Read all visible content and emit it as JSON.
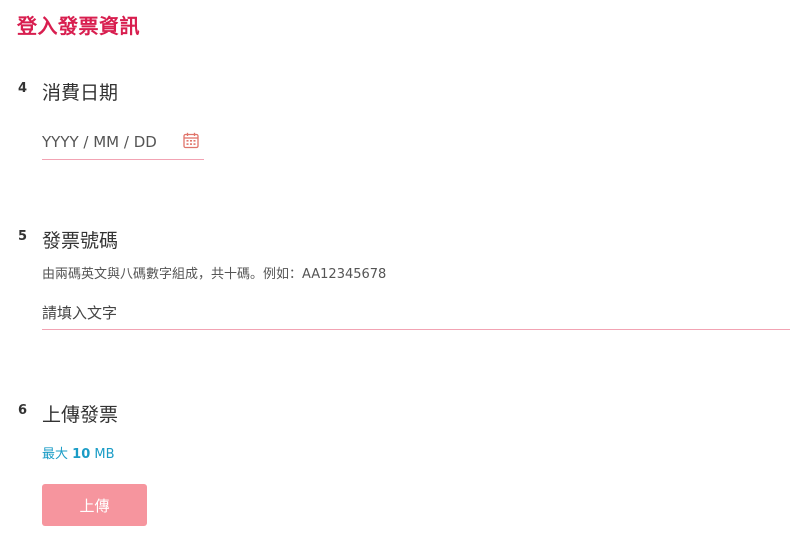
{
  "page": {
    "title": "登入發票資訊"
  },
  "questions": [
    {
      "number": "4",
      "title": "消費日期",
      "placeholder": "YYYY / MM / DD",
      "icon": "calendar-icon"
    },
    {
      "number": "5",
      "title": "發票號碼",
      "description": "由兩碼英文與八碼數字組成，共十碼。例如：AA12345678",
      "placeholder": "請填入文字"
    },
    {
      "number": "6",
      "title": "上傳發票",
      "limit_prefix": "最大",
      "limit_value": "10",
      "limit_unit": "MB",
      "button_label": "上傳"
    }
  ],
  "colors": {
    "title": "#d81e4f",
    "underline": "#f2a3b3",
    "button": "#f6959e",
    "limit": "#1a9cc6"
  }
}
